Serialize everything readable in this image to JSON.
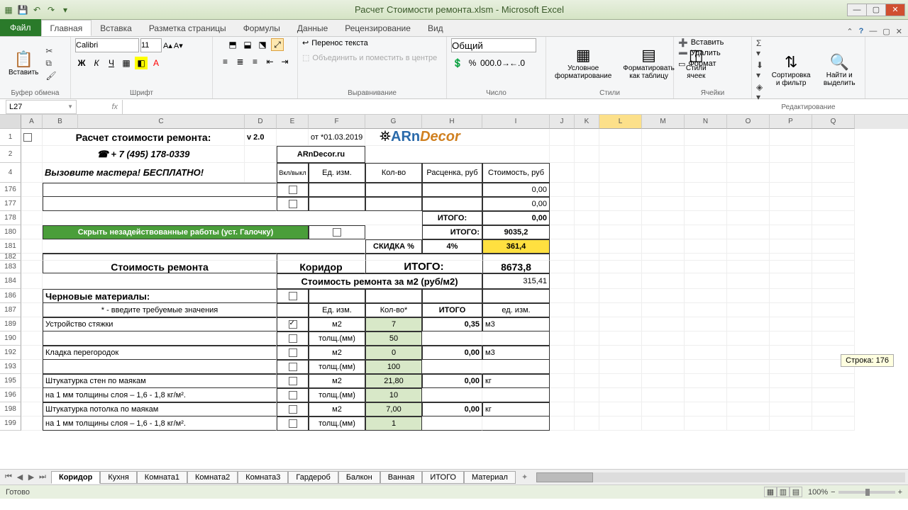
{
  "window": {
    "title": "Расчет Стоимости ремонта.xlsm - Microsoft Excel",
    "name_box": "L27",
    "formula": "",
    "status": "Готово",
    "zoom": "100%",
    "tooltip": "Строка: 176"
  },
  "ribbon": {
    "file": "Файл",
    "tabs": [
      "Главная",
      "Вставка",
      "Разметка страницы",
      "Формулы",
      "Данные",
      "Рецензирование",
      "Вид"
    ],
    "groups": {
      "clipboard": {
        "label": "Буфер обмена",
        "paste": "Вставить"
      },
      "font": {
        "label": "Шрифт",
        "name": "Calibri",
        "size": "11"
      },
      "align": {
        "label": "Выравнивание",
        "wrap": "Перенос текста",
        "merge": "Объединить и поместить в центре"
      },
      "number": {
        "label": "Число",
        "format": "Общий"
      },
      "styles": {
        "label": "Стили",
        "cond": "Условное форматирование",
        "table": "Форматировать как таблицу",
        "cell": "Стили ячеек"
      },
      "cells": {
        "label": "Ячейки",
        "insert": "Вставить",
        "delete": "Удалить",
        "format": "Формат"
      },
      "editing": {
        "label": "Редактирование",
        "sort": "Сортировка и фильтр",
        "find": "Найти и выделить"
      }
    }
  },
  "cols": [
    "A",
    "B",
    "C",
    "D",
    "E",
    "F",
    "G",
    "H",
    "I",
    "J",
    "K",
    "L",
    "M",
    "N",
    "O",
    "P",
    "Q"
  ],
  "row_nums": [
    "1",
    "2",
    "4",
    "176",
    "177",
    "178",
    "180",
    "181",
    "182",
    "183",
    "184",
    "186",
    "187",
    "189",
    "190",
    "192",
    "193",
    "195",
    "196",
    "198",
    "199"
  ],
  "sheet": {
    "r1": {
      "title": "Расчет стоимости ремонта:",
      "ver": "v 2.0",
      "date": "от *01.03.2019"
    },
    "r2": {
      "phone": "☎ + 7 (495) 178-0339",
      "site": "ARnDecor.ru",
      "brand1": "ARn",
      "brand2": "Decor"
    },
    "r4": {
      "call": "Вызовите мастера",
      "free": "! БЕСПЛАТНО!",
      "h1": "Вкл/выкл",
      "h2": "Ед. изм.",
      "h3": "Кол-во",
      "h4": "Расценка, руб",
      "h5": "Стоимость, руб"
    },
    "r176_cost": "0,00",
    "r177_cost": "0,00",
    "r178": {
      "itogo": "ИТОГО:",
      "val": "0,00"
    },
    "r180": {
      "hide": "Скрыть незадействованные работы (уст. Галочку)",
      "itogo": "ИТОГО:",
      "val": "9035,2"
    },
    "r181": {
      "disc": "СКИДКА %",
      "pct": "4%",
      "val": "361,4"
    },
    "r182": {
      "title": "Стоимость ремонта",
      "room": "Коридор",
      "itogo": "ИТОГО:",
      "val": "8673,8"
    },
    "r184": {
      "label": "Стоимость ремонта за м2 (руб/м2)",
      "val": "315,41"
    },
    "r186": {
      "title": "Черновые материалы:"
    },
    "r187": {
      "note": "* - введите требуемые значения",
      "h1": "Ед. изм.",
      "h2": "Кол-во*",
      "h3": "ИТОГО",
      "h4": "ед. изм."
    },
    "r189": {
      "name": "Устройство стяжки",
      "unit": "м2",
      "qty": "7",
      "total": "0,35",
      "tu": "м3"
    },
    "r190": {
      "unit": "толщ.(мм)",
      "qty": "50"
    },
    "r192": {
      "name": "Кладка перегородок",
      "unit": "м2",
      "qty": "0",
      "total": "0,00",
      "tu": "м3"
    },
    "r193": {
      "unit": "толщ.(мм)",
      "qty": "100"
    },
    "r195": {
      "name": "Штукатурка стен по маякам",
      "unit": "м2",
      "qty": "21,80",
      "total": "0,00",
      "tu": "кг"
    },
    "r196": {
      "note": "на 1 мм толщины слоя – 1,6 - 1,8 кг/м².",
      "unit": "толщ.(мм)",
      "qty": "10"
    },
    "r198": {
      "name": "Штукатурка потолка по маякам",
      "unit": "м2",
      "qty": "7,00",
      "total": "0,00",
      "tu": "кг"
    },
    "r199": {
      "note": "на 1 мм толщины слоя – 1,6 - 1,8 кг/м².",
      "unit": "толщ.(мм)",
      "qty": "1"
    }
  },
  "sheet_tabs": [
    "Коридор",
    "Кухня",
    "Комната1",
    "Комната2",
    "Комната3",
    "Гардероб",
    "Балкон",
    "Ванная",
    "ИТОГО",
    "Материал"
  ]
}
